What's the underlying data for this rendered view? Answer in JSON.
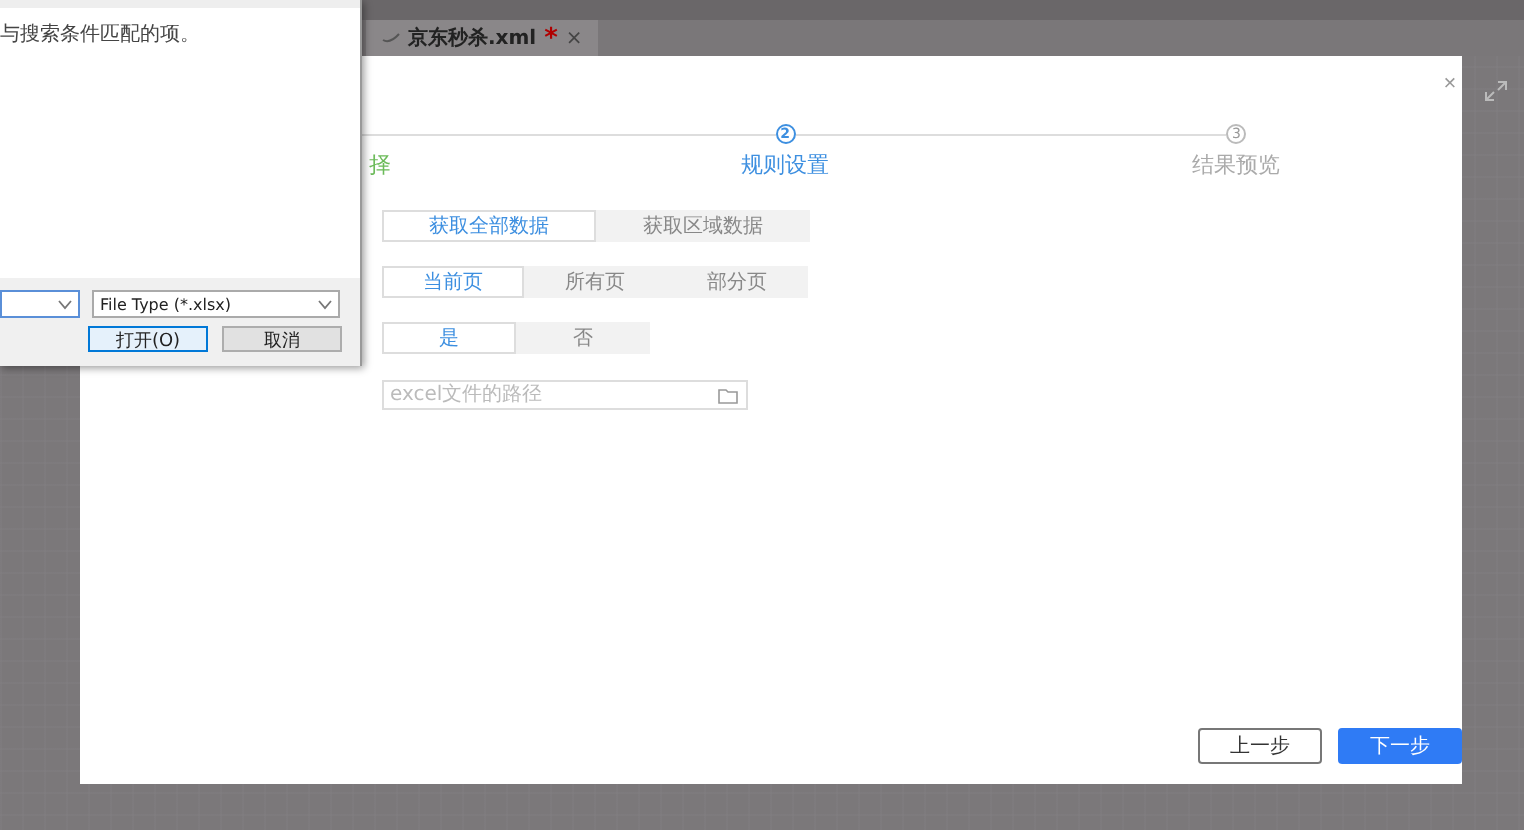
{
  "editor_tab": {
    "title": "京东秒杀.xml",
    "modified_mark": "*",
    "close": "×"
  },
  "file_dialog": {
    "message": "与搜索条件匹配的项。",
    "file_type": "File Type (*.xlsx)",
    "buttons": [
      {
        "label": "打开(O)",
        "kind": "default"
      },
      {
        "label": "取消",
        "kind": "normal"
      }
    ]
  },
  "wizard": {
    "close": "×",
    "steps": [
      {
        "label": "择",
        "completed": true,
        "selected": false
      },
      {
        "number": "2",
        "label": "规则设置",
        "completed": false,
        "selected": true
      },
      {
        "number": "3",
        "label": "结果预览",
        "completed": false,
        "selected": false
      }
    ],
    "option_groups": [
      {
        "options": [
          {
            "label": "获取全部数据",
            "selected": true
          },
          {
            "label": "获取区域数据",
            "selected": false
          }
        ]
      },
      {
        "options": [
          {
            "label": "当前页",
            "selected": true
          },
          {
            "label": "所有页",
            "selected": false
          },
          {
            "label": "部分页",
            "selected": false
          }
        ]
      },
      {
        "options": [
          {
            "label": "是",
            "selected": true
          },
          {
            "label": "否",
            "selected": false
          }
        ]
      }
    ],
    "path_field": {
      "placeholder": "excel文件的路径"
    },
    "buttons": [
      {
        "label": "上一步",
        "kind": "secondary"
      },
      {
        "label": "下一步",
        "kind": "primary"
      }
    ]
  }
}
